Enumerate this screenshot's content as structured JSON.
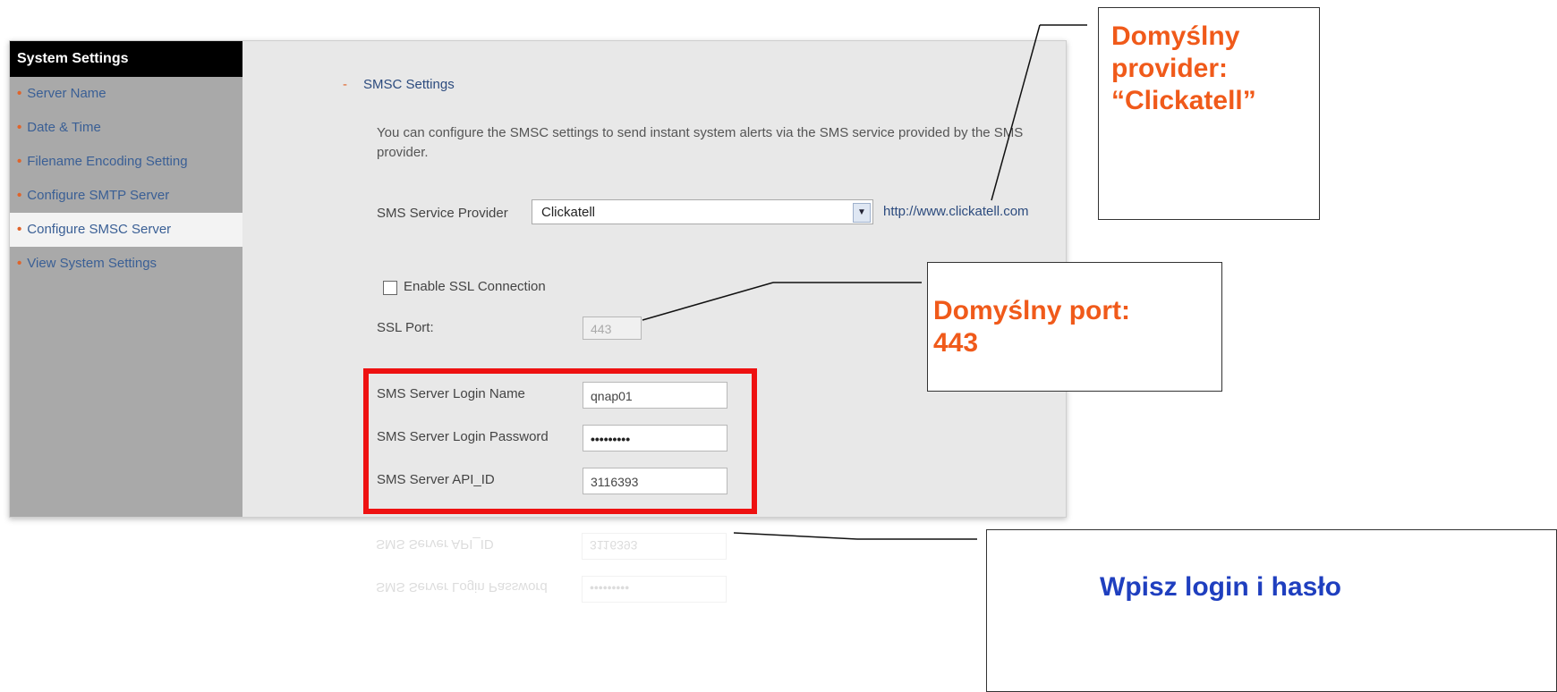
{
  "sidebar": {
    "title": "System Settings",
    "items": [
      {
        "label": "Server Name"
      },
      {
        "label": "Date & Time"
      },
      {
        "label": "Filename Encoding Setting"
      },
      {
        "label": "Configure SMTP Server"
      },
      {
        "label": "Configure SMSC Server",
        "active": true
      },
      {
        "label": "View System Settings"
      }
    ]
  },
  "main": {
    "section_title": "SMSC Settings",
    "description": "You can configure the SMSC settings to send instant system alerts via the SMS service provided by the SMS provider.",
    "provider_label": "SMS Service Provider",
    "provider_value": "Clickatell",
    "provider_link": "http://www.clickatell.com",
    "ssl_label": "Enable SSL Connection",
    "ssl_checked": false,
    "ssl_port_label": "SSL Port:",
    "ssl_port_value": "443",
    "login_name_label": "SMS Server Login Name",
    "login_name_value": "qnap01",
    "password_label": "SMS Server Login Password",
    "password_value": "•••••••••",
    "api_id_label": "SMS Server API_ID",
    "api_id_value": "3116393"
  },
  "callouts": {
    "provider": [
      "Domyślny",
      "provider:",
      "“Clickatell”"
    ],
    "port": [
      "Domyślny port:",
      "443"
    ],
    "login": "Wpisz login i hasło"
  },
  "colors": {
    "highlight_box": "#ee1111",
    "callout_orange": "#f05a1a",
    "callout_blue": "#1f3fbf"
  }
}
